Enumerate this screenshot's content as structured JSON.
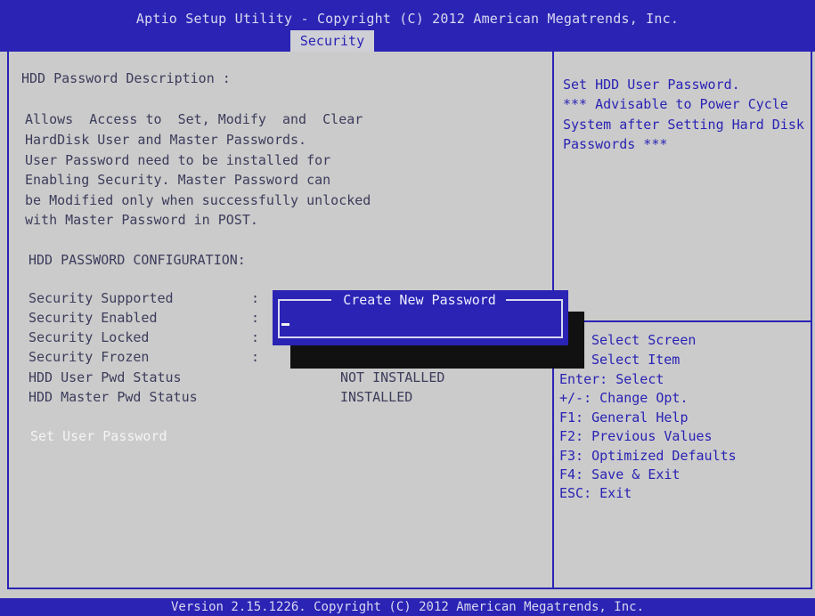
{
  "header": {
    "title": "Aptio Setup Utility - Copyright (C) 2012 American Megatrends, Inc.",
    "active_tab": "Security"
  },
  "left": {
    "description_heading": "HDD Password Description :",
    "description_lines": [
      "Allows  Access to  Set, Modify  and  Clear",
      "HardDisk User and Master Passwords.",
      "User Password need to be installed for",
      "Enabling Security. Master Password can",
      "be Modified only when successfully unlocked",
      "with Master Password in POST."
    ],
    "config_heading": "HDD PASSWORD CONFIGURATION:",
    "rows": [
      {
        "label": "Security Supported",
        "colon": ":",
        "value": ""
      },
      {
        "label": "Security Enabled",
        "colon": ":",
        "value": ""
      },
      {
        "label": "Security Locked",
        "colon": ":",
        "value": ""
      },
      {
        "label": "Security Frozen",
        "colon": ":",
        "value": ""
      },
      {
        "label": "HDD User Pwd Status",
        "colon": "",
        "value": "NOT INSTALLED"
      },
      {
        "label": "HDD Master Pwd Status",
        "colon": "",
        "value": "INSTALLED"
      }
    ],
    "selected_item": "Set User Password"
  },
  "help": {
    "lines": [
      "Set HDD User Password.",
      "*** Advisable to Power Cycle",
      "System after Setting Hard Disk",
      "Passwords ***"
    ]
  },
  "keys": [
    "Select Screen",
    "Select Item",
    "Enter: Select",
    "+/-: Change Opt.",
    "F1: General Help",
    "F2: Previous Values",
    "F3: Optimized Defaults",
    "F4: Save & Exit",
    "ESC: Exit"
  ],
  "dialog": {
    "title": "Create New Password",
    "value": ""
  },
  "footer": {
    "text": "Version 2.15.1226. Copyright (C) 2012 American Megatrends, Inc."
  },
  "colors": {
    "bios_blue": "#2a23b4",
    "background_gray": "#cbcbcb",
    "selected_text": "#f4f4f4"
  }
}
